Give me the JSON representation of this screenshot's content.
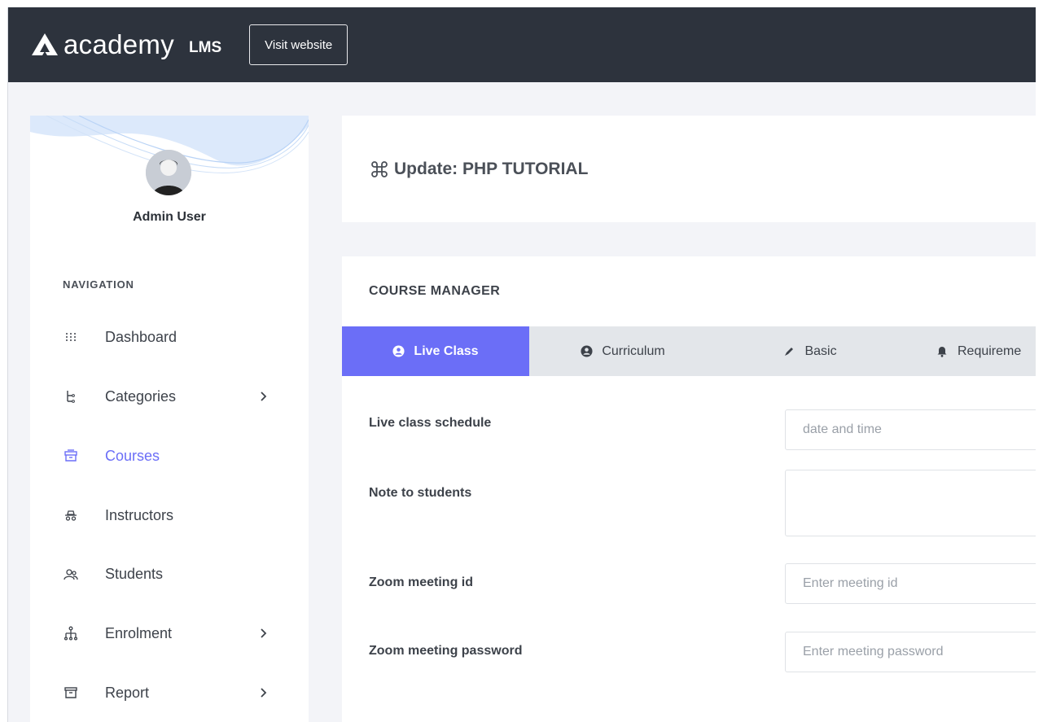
{
  "header": {
    "logo_text": "academy",
    "logo_suffix": "LMS",
    "visit_button": "Visit website"
  },
  "sidebar": {
    "user_name": "Admin User",
    "nav_title": "NAVIGATION",
    "items": [
      {
        "label": "Dashboard",
        "icon": "grid-dots-icon",
        "has_chevron": false
      },
      {
        "label": "Categories",
        "icon": "tree-icon",
        "has_chevron": true
      },
      {
        "label": "Courses",
        "icon": "archive-box-icon",
        "has_chevron": false,
        "active": true
      },
      {
        "label": "Instructors",
        "icon": "incognito-icon",
        "has_chevron": false
      },
      {
        "label": "Students",
        "icon": "users-icon",
        "has_chevron": false
      },
      {
        "label": "Enrolment",
        "icon": "hierarchy-icon",
        "has_chevron": true
      },
      {
        "label": "Report",
        "icon": "archive-icon",
        "has_chevron": true
      }
    ],
    "active_color": "#6b6ef7"
  },
  "page": {
    "title": "Update: PHP TUTORIAL",
    "title_icon": "command-icon"
  },
  "course_manager": {
    "title": "COURSE MANAGER",
    "tabs": [
      {
        "label": "Live Class",
        "icon": "account-circle-icon",
        "active": true
      },
      {
        "label": "Curriculum",
        "icon": "account-circle-icon"
      },
      {
        "label": "Basic",
        "icon": "pen-icon"
      },
      {
        "label": "Requireme",
        "icon": "bell-icon"
      }
    ],
    "fields": {
      "schedule_label": "Live class schedule",
      "schedule_placeholder": "date and time",
      "note_label": "Note to students",
      "note_value": "",
      "meeting_id_label": "Zoom meeting id",
      "meeting_id_placeholder": "Enter meeting id",
      "meeting_password_label": "Zoom meeting password",
      "meeting_password_placeholder": "Enter meeting password"
    }
  },
  "colors": {
    "topbar": "#2d333d",
    "accent": "#6b6ef7",
    "background": "#f3f4f8"
  }
}
